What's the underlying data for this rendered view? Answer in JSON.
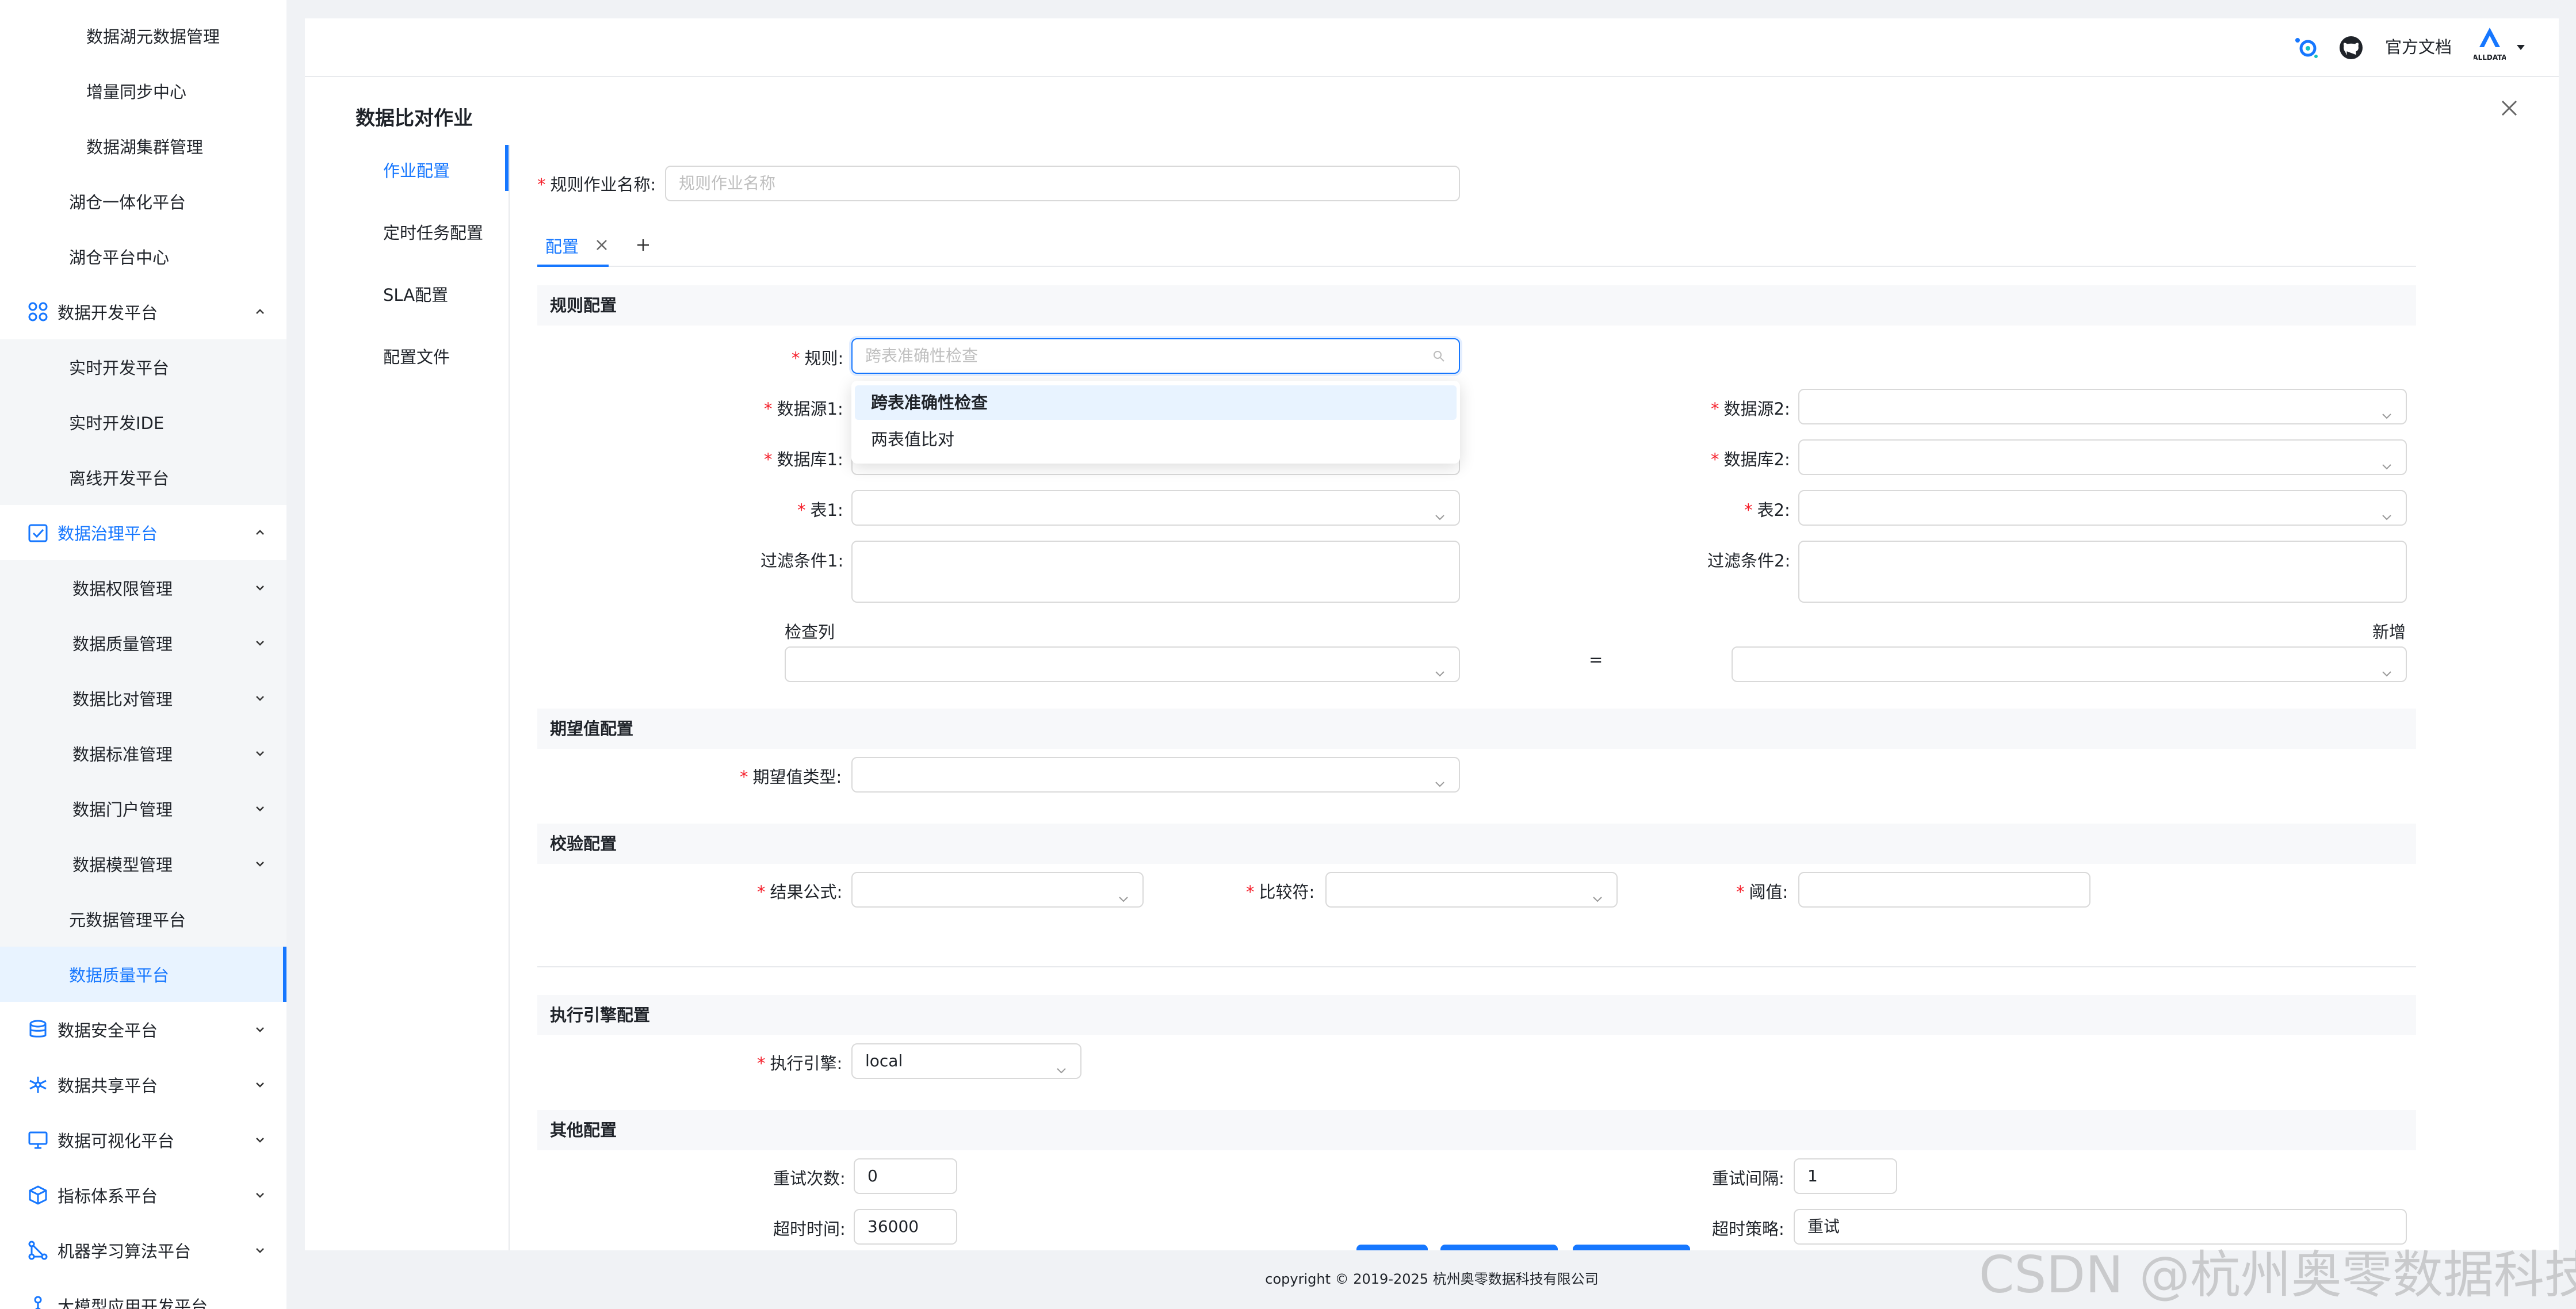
{
  "sidebar": {
    "items": [
      {
        "label": "数据湖元数据管理"
      },
      {
        "label": "增量同步中心"
      },
      {
        "label": "数据湖集群管理"
      },
      {
        "label": "湖仓一体化平台"
      },
      {
        "label": "湖仓平台中心"
      },
      {
        "label": "数据开发平台",
        "icon": "apps-icon",
        "expanded": true
      },
      {
        "label": "实时开发平台"
      },
      {
        "label": "实时开发IDE"
      },
      {
        "label": "离线开发平台"
      },
      {
        "label": "数据治理平台",
        "icon": "checklist-icon",
        "expanded": true
      },
      {
        "label": "数据权限管理"
      },
      {
        "label": "数据质量管理"
      },
      {
        "label": "数据比对管理"
      },
      {
        "label": "数据标准管理"
      },
      {
        "label": "数据门户管理"
      },
      {
        "label": "数据模型管理"
      },
      {
        "label": "元数据管理平台"
      },
      {
        "label": "数据质量平台",
        "active": true
      },
      {
        "label": "数据安全平台",
        "icon": "database-icon"
      },
      {
        "label": "数据共享平台",
        "icon": "share-icon"
      },
      {
        "label": "数据可视化平台",
        "icon": "monitor-icon"
      },
      {
        "label": "指标体系平台",
        "icon": "cube-icon"
      },
      {
        "label": "机器学习算法平台",
        "icon": "ml-icon"
      },
      {
        "label": "大模型应用开发平台",
        "icon": "llm-icon"
      }
    ]
  },
  "header": {
    "docs_label": "官方文档",
    "logo_text": "ALLDATA"
  },
  "panel": {
    "title": "数据比对作业",
    "nav": [
      "作业配置",
      "定时任务配置",
      "SLA配置",
      "配置文件"
    ],
    "job_name_label": "规则作业名称:",
    "job_name_placeholder": "规则作业名称",
    "tab_label": "配置",
    "rule_section": "规则配置",
    "rule_label": "规则:",
    "rule_placeholder": "跨表准确性检查",
    "rule_options": [
      "跨表准确性检查",
      "两表值比对"
    ],
    "ds1_label": "数据源1:",
    "ds2_label": "数据源2:",
    "db1_label": "数据库1:",
    "db2_label": "数据库2:",
    "t1_label": "表1:",
    "t2_label": "表2:",
    "filter1_label": "过滤条件1:",
    "filter2_label": "过滤条件2:",
    "check_col_label": "检查列",
    "add_label": "新增",
    "equals": "=",
    "expected_section": "期望值配置",
    "expected_type_label": "期望值类型:",
    "verify_section": "校验配置",
    "result_formula_label": "结果公式:",
    "comparator_label": "比较符:",
    "threshold_label": "阈值:",
    "engine_section": "执行引擎配置",
    "engine_label": "执行引擎:",
    "engine_value": "local",
    "other_section": "其他配置",
    "retry_count_label": "重试次数:",
    "retry_count_value": "0",
    "retry_interval_label": "重试间隔:",
    "retry_interval_value": "1",
    "timeout_label": "超时时间:",
    "timeout_value": "36000",
    "timeout_policy_label": "超时策略:",
    "timeout_policy_value": "重试"
  },
  "footer": {
    "copyright": "copyright © 2019-2025 杭州奥零数据科技有限公司"
  },
  "watermark": "CSDN @杭州奥零数据科技",
  "colors": {
    "accent": "#1677ff",
    "required": "#f5222d",
    "sidebar_active_bg": "#e8f3ff"
  }
}
